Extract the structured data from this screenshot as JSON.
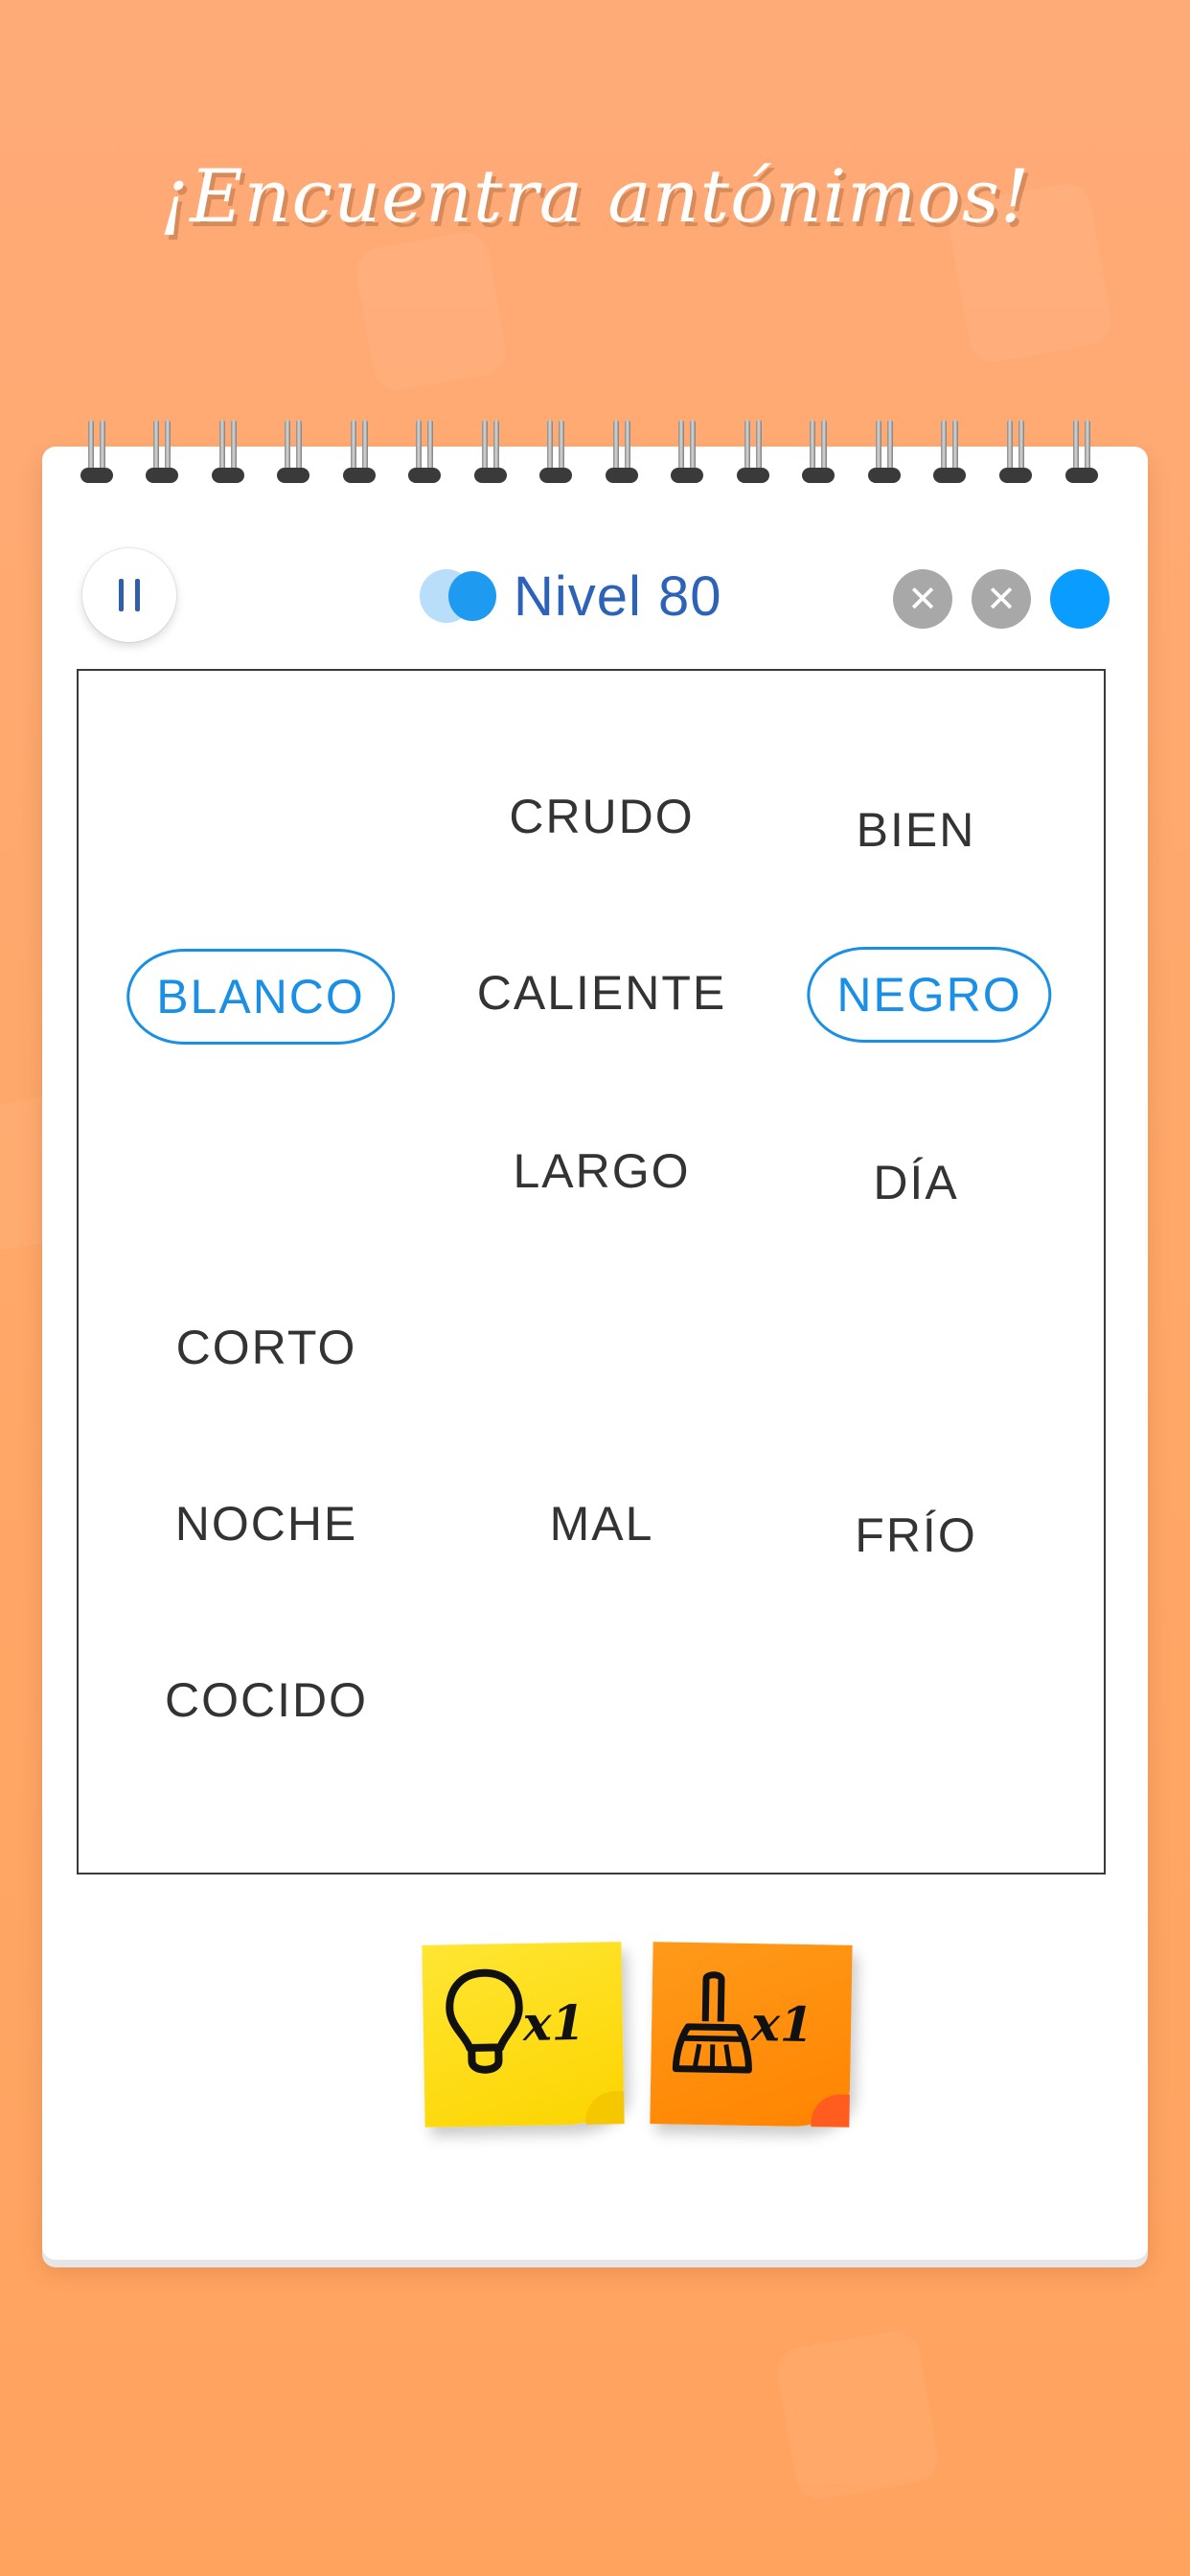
{
  "promo": {
    "title": "¡Encuentra antónimos!"
  },
  "header": {
    "pause_icon": "pause-icon",
    "level_label": "Nivel 80",
    "lives": [
      {
        "state": "lost",
        "symbol": "✕"
      },
      {
        "state": "lost",
        "symbol": "✕"
      },
      {
        "state": "active",
        "symbol": ""
      }
    ]
  },
  "board": {
    "words": [
      {
        "text": "CRUDO",
        "selected": false
      },
      {
        "text": "BIEN",
        "selected": false
      },
      {
        "text": "BLANCO",
        "selected": true
      },
      {
        "text": "CALIENTE",
        "selected": false
      },
      {
        "text": "NEGRO",
        "selected": true
      },
      {
        "text": "LARGO",
        "selected": false
      },
      {
        "text": "DÍA",
        "selected": false
      },
      {
        "text": "CORTO",
        "selected": false
      },
      {
        "text": "NOCHE",
        "selected": false
      },
      {
        "text": "MAL",
        "selected": false
      },
      {
        "text": "FRÍO",
        "selected": false
      },
      {
        "text": "COCIDO",
        "selected": false
      }
    ]
  },
  "powerups": [
    {
      "name": "hint",
      "icon": "lightbulb-icon",
      "count_label": "x1",
      "color": "#fcd400"
    },
    {
      "name": "clear",
      "icon": "broom-icon",
      "count_label": "x1",
      "color": "#ff8a00"
    }
  ],
  "colors": {
    "background": "#ffa767",
    "accent_blue": "#1a8fe6",
    "level_text": "#2c62b8",
    "lost_life": "#a8a8a8",
    "active_life": "#0a9cff"
  }
}
